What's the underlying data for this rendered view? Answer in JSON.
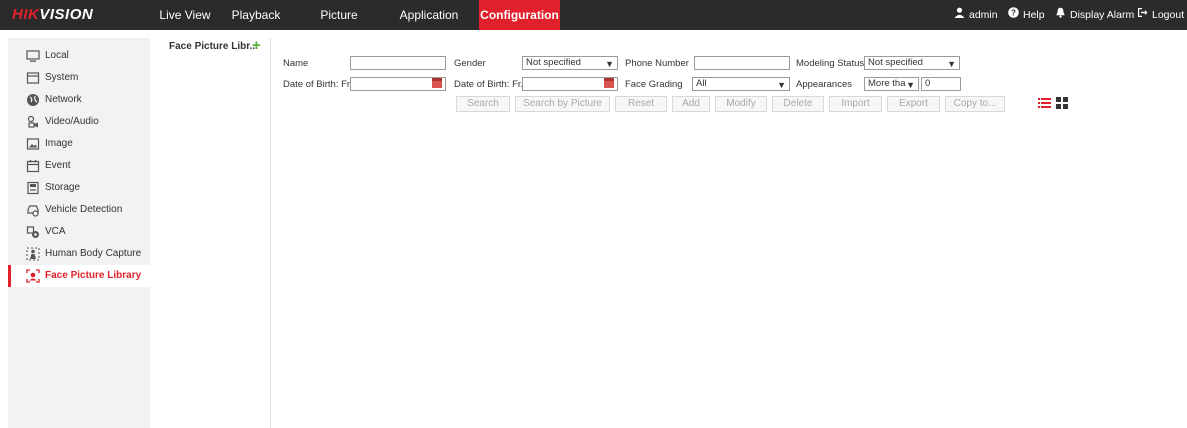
{
  "app": {
    "logo_red": "HIK",
    "logo_white": "VISION"
  },
  "nav": {
    "items": [
      {
        "label": "Live View"
      },
      {
        "label": "Playback"
      },
      {
        "label": "Picture"
      },
      {
        "label": "Application"
      },
      {
        "label": "Configuration",
        "active": true
      }
    ]
  },
  "header_right": {
    "user": "admin",
    "help": "Help",
    "display_alarm": "Display Alarm",
    "logout": "Logout"
  },
  "sidebar": {
    "items": [
      {
        "label": "Local",
        "icon": "monitor-icon"
      },
      {
        "label": "System",
        "icon": "system-icon"
      },
      {
        "label": "Network",
        "icon": "globe-icon"
      },
      {
        "label": "Video/Audio",
        "icon": "video-audio-icon"
      },
      {
        "label": "Image",
        "icon": "image-icon"
      },
      {
        "label": "Event",
        "icon": "calendar-icon"
      },
      {
        "label": "Storage",
        "icon": "storage-icon"
      },
      {
        "label": "Vehicle Detection",
        "icon": "vehicle-icon"
      },
      {
        "label": "VCA",
        "icon": "vca-icon"
      },
      {
        "label": "Human Body Capture",
        "icon": "human-body-icon"
      },
      {
        "label": "Face Picture Library",
        "icon": "face-icon",
        "active": true
      }
    ]
  },
  "library": {
    "title": "Face Picture Libr...",
    "add_symbol": "+"
  },
  "search_form": {
    "name_label": "Name",
    "name_value": "",
    "gender_label": "Gender",
    "gender_value": "Not specified",
    "phone_label": "Phone Number",
    "phone_value": "",
    "modeling_label": "Modeling Status",
    "modeling_value": "Not specified",
    "dob_from_label": "Date of Birth: Fr...",
    "dob_from_value": "",
    "dob_to_label": "Date of Birth: Fr...",
    "dob_to_value": "",
    "grading_label": "Face Grading",
    "grading_value": "All",
    "appearances_label": "Appearances",
    "appearances_op": "More tha",
    "appearances_value": "0"
  },
  "buttons": {
    "search": "Search",
    "search_by_picture": "Search by Picture",
    "reset": "Reset",
    "add": "Add",
    "modify": "Modify",
    "delete": "Delete",
    "import": "Import",
    "export": "Export",
    "copy_to": "Copy to..."
  },
  "colors": {
    "accent": "#e0212b",
    "topbar": "#2b2b2b",
    "sidebar_bg": "#f2f2f2",
    "add_green": "#55b030"
  }
}
